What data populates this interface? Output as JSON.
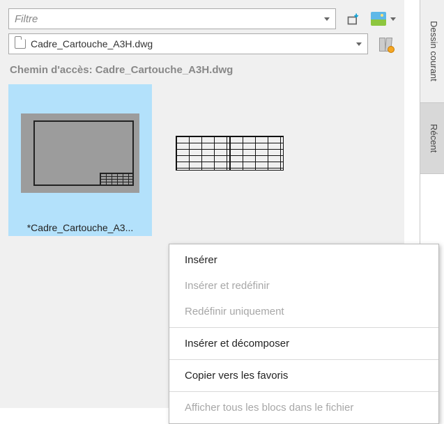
{
  "filter": {
    "placeholder": "Filtre"
  },
  "file": {
    "name": "Cadre_Cartouche_A3H.dwg"
  },
  "path": {
    "label": "Chemin d'accès: Cadre_Cartouche_A3H.dwg"
  },
  "tiles": [
    {
      "caption": "*Cadre_Cartouche_A3..."
    },
    {
      "caption": ""
    }
  ],
  "menu": {
    "insert": "Insérer",
    "insert_redefine": "Insérer et redéfinir",
    "redefine_only": "Redéfinir uniquement",
    "insert_explode": "Insérer et décomposer",
    "copy_favorites": "Copier vers les favoris",
    "show_all": "Afficher tous les blocs dans le fichier"
  },
  "tabs": {
    "current": "Dessin courant",
    "recent": "Récent"
  }
}
